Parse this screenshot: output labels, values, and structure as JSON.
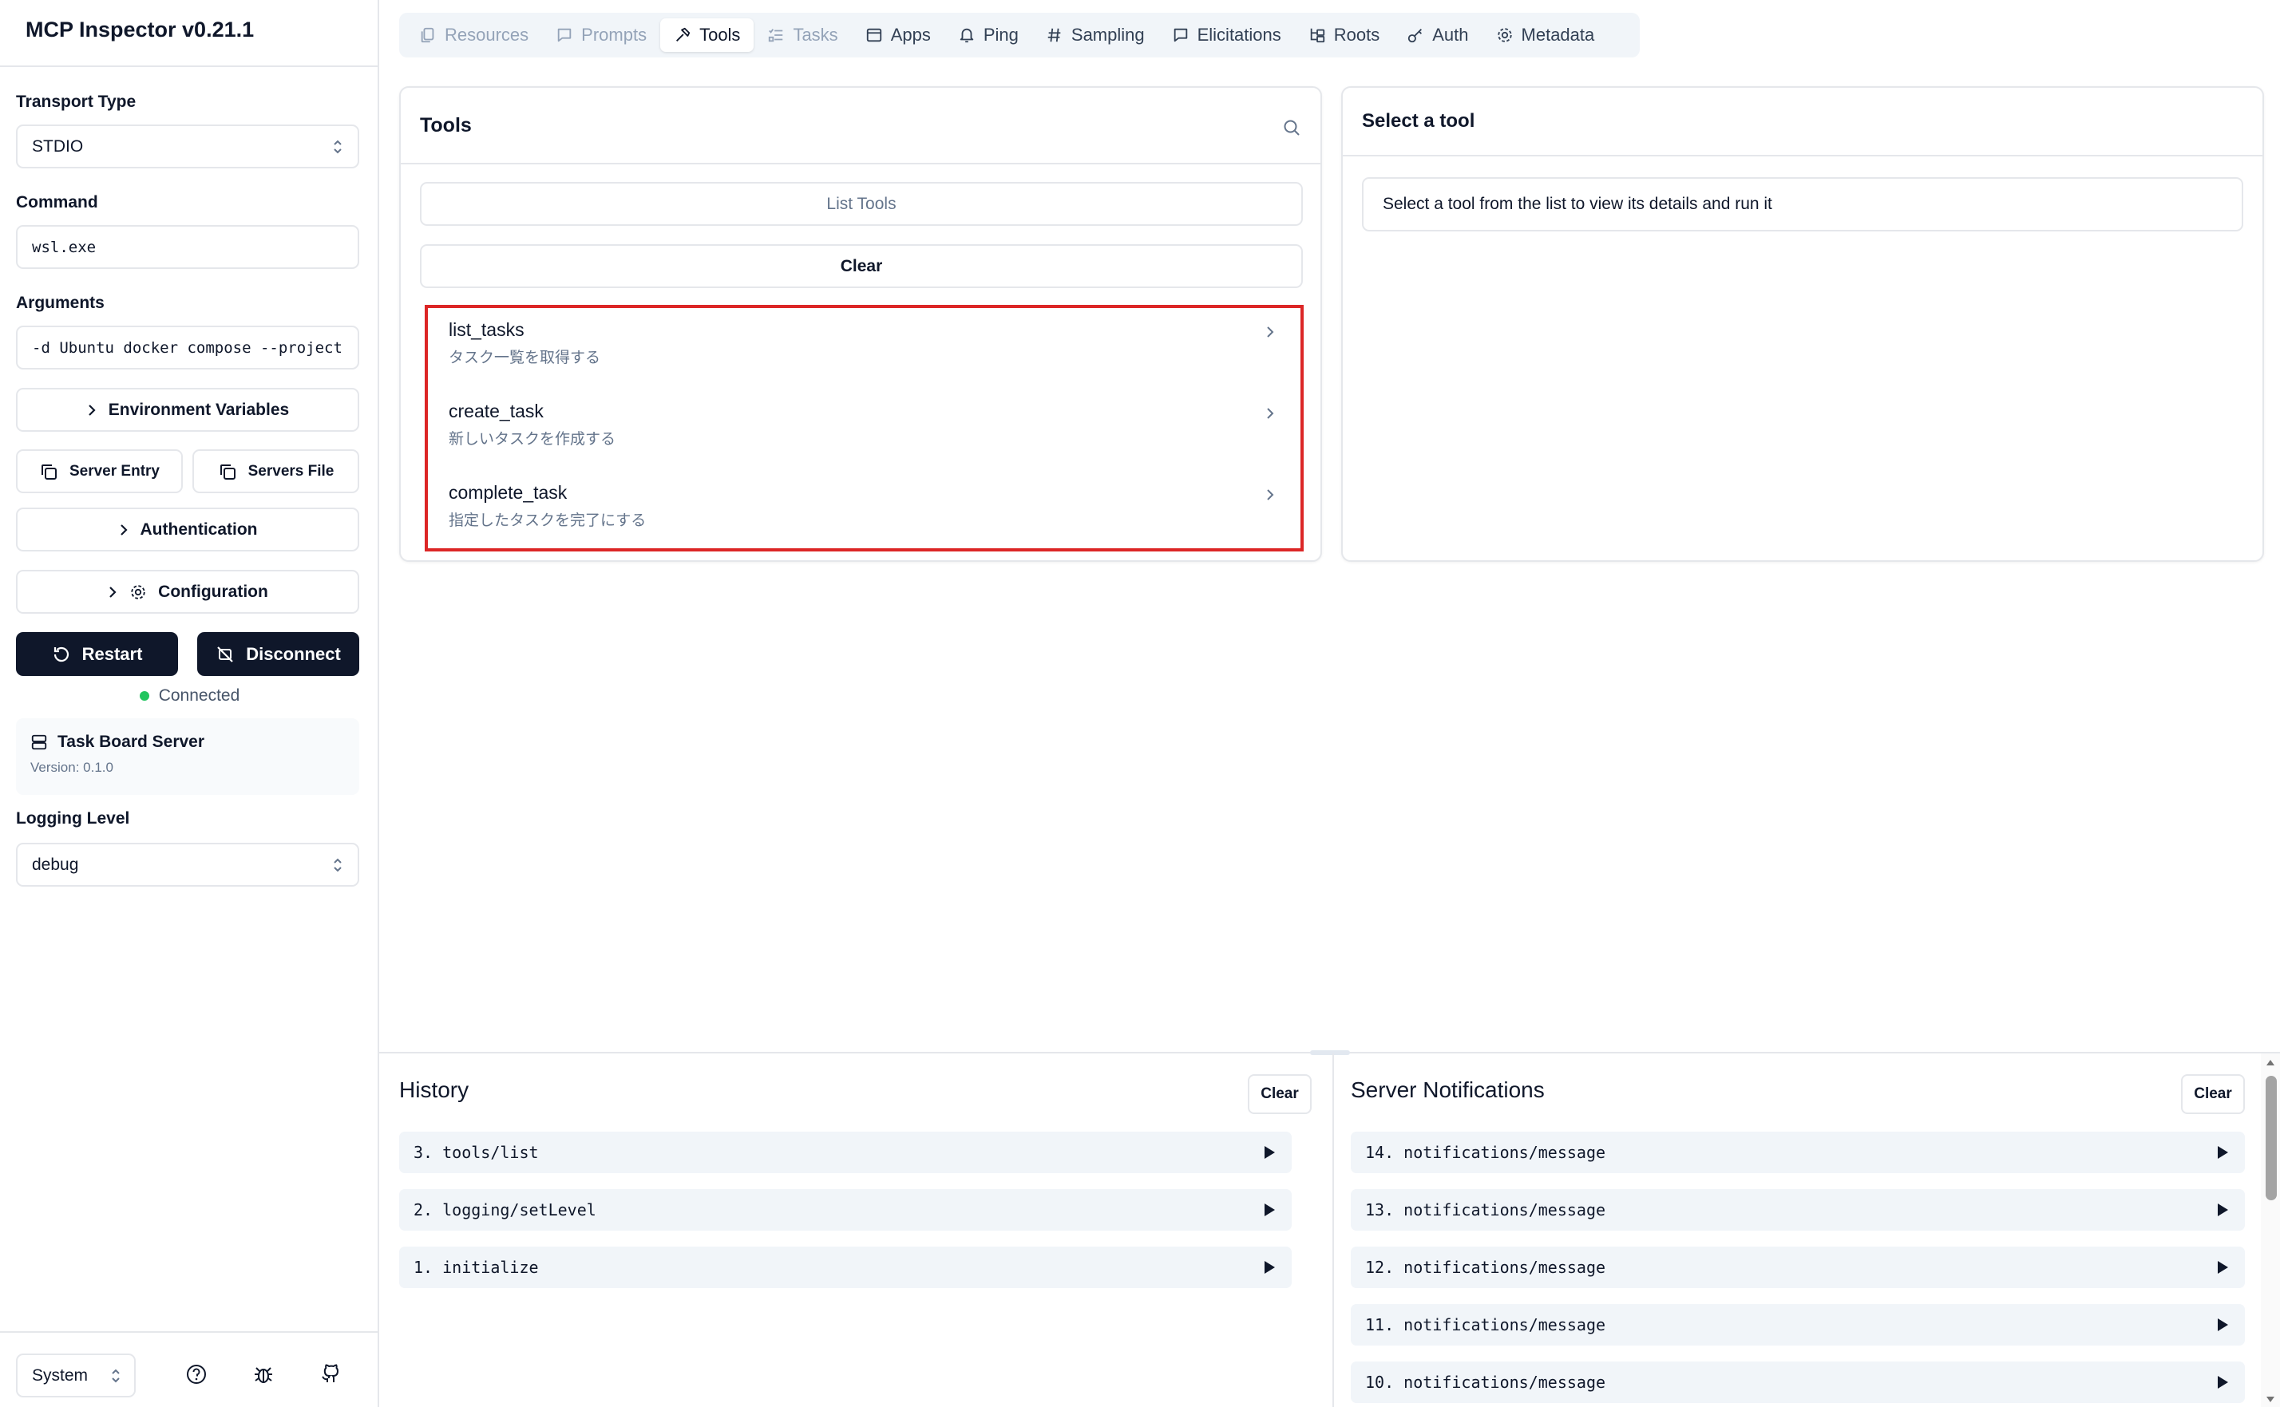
{
  "app": {
    "title": "MCP Inspector v0.21.1"
  },
  "sidebar": {
    "transport_label": "Transport Type",
    "transport_value": "STDIO",
    "command_label": "Command",
    "command_value": "wsl.exe",
    "arguments_label": "Arguments",
    "arguments_value": "-d Ubuntu docker compose --project",
    "env_vars_label": "Environment Variables",
    "server_entry_label": "Server Entry",
    "servers_file_label": "Servers File",
    "authentication_label": "Authentication",
    "configuration_label": "Configuration",
    "restart_label": "Restart",
    "disconnect_label": "Disconnect",
    "status_text": "Connected",
    "status_color": "#22c55e",
    "server_name": "Task Board Server",
    "server_version": "Version: 0.1.0",
    "logging_label": "Logging Level",
    "logging_value": "debug",
    "theme_value": "System"
  },
  "tabs": [
    {
      "label": "Resources",
      "icon": "files-icon",
      "state": "disabled"
    },
    {
      "label": "Prompts",
      "icon": "message-square-icon",
      "state": "disabled"
    },
    {
      "label": "Tools",
      "icon": "hammer-icon",
      "state": "active"
    },
    {
      "label": "Tasks",
      "icon": "list-todo-icon",
      "state": "disabled"
    },
    {
      "label": "Apps",
      "icon": "app-window-icon",
      "state": "normal"
    },
    {
      "label": "Ping",
      "icon": "bell-icon",
      "state": "normal"
    },
    {
      "label": "Sampling",
      "icon": "hash-icon",
      "state": "normal"
    },
    {
      "label": "Elicitations",
      "icon": "message-square-icon",
      "state": "normal"
    },
    {
      "label": "Roots",
      "icon": "folder-tree-icon",
      "state": "normal"
    },
    {
      "label": "Auth",
      "icon": "key-icon",
      "state": "normal"
    },
    {
      "label": "Metadata",
      "icon": "gear-icon",
      "state": "normal"
    }
  ],
  "tools_panel": {
    "title": "Tools",
    "list_tools_label": "List Tools",
    "clear_label": "Clear",
    "items": [
      {
        "name": "list_tasks",
        "description": "タスク一覧を取得する"
      },
      {
        "name": "create_task",
        "description": "新しいタスクを作成する"
      },
      {
        "name": "complete_task",
        "description": "指定したタスクを完了にする"
      }
    ],
    "highlight_color": "#dc2626"
  },
  "detail_panel": {
    "title": "Select a tool",
    "info": "Select a tool from the list to view its details and run it"
  },
  "history": {
    "title": "History",
    "clear_label": "Clear",
    "entries": [
      "3. tools/list",
      "2. logging/setLevel",
      "1. initialize"
    ]
  },
  "notifications": {
    "title": "Server Notifications",
    "clear_label": "Clear",
    "entries": [
      "14. notifications/message",
      "13. notifications/message",
      "12. notifications/message",
      "11. notifications/message",
      "10. notifications/message"
    ]
  }
}
